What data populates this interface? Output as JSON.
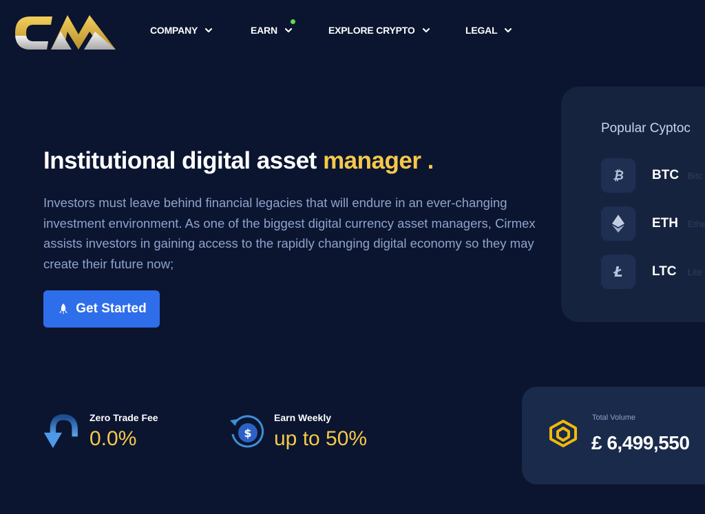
{
  "brand": {
    "logo_text": "CM",
    "colors": {
      "gold": "#f5c84a",
      "silver": "#d9d9d9",
      "accent": "#2f6eea"
    }
  },
  "nav": {
    "items": [
      {
        "label": "COMPANY",
        "icon": "chevron-down-icon"
      },
      {
        "label": "EARN",
        "icon": "chevron-down-icon",
        "badge": "green-dot"
      },
      {
        "label": "EXPLORE CRYPTO",
        "icon": "chevron-down-icon"
      },
      {
        "label": "LEGAL",
        "icon": "chevron-down-icon"
      }
    ]
  },
  "hero": {
    "title_main": "Institutional digital asset ",
    "title_accent": "manager .",
    "description": "Investors must leave behind financial legacies that will endure in an ever-changing investment environment. As one of the biggest digital currency asset managers, Cirmex assists investors in gaining access to the rapidly changing digital economy so they may create their future now;",
    "cta_label": "Get Started"
  },
  "crypto_panel": {
    "title": "Popular Cyptoc",
    "coins": [
      {
        "symbol": "BTC",
        "name": "Bitc",
        "icon": "bitcoin-icon"
      },
      {
        "symbol": "ETH",
        "name": "Ethe",
        "icon": "ethereum-icon"
      },
      {
        "symbol": "LTC",
        "name": "Lite",
        "icon": "litecoin-icon"
      }
    ]
  },
  "stats": [
    {
      "label": "Zero Trade Fee",
      "value": "0.0%",
      "icon": "down-arrow-icon"
    },
    {
      "label": "Earn Weekly",
      "value": "up to 50%",
      "icon": "dollar-cycle-icon"
    }
  ],
  "volume": {
    "label": "Total Volume",
    "value": "£ 6,499,550",
    "icon": "bnb-icon"
  }
}
